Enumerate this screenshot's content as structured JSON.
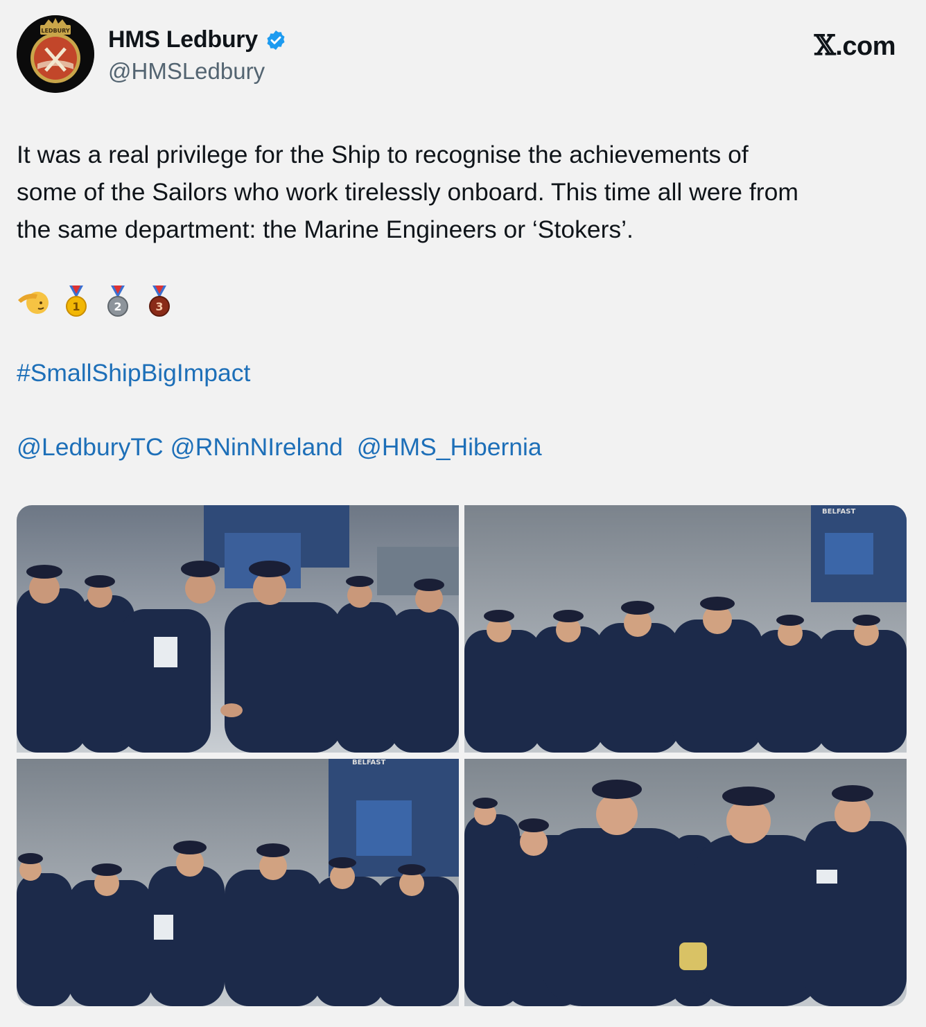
{
  "author": {
    "display_name": "HMS Ledbury",
    "handle": "@HMSLedbury",
    "verified": true,
    "avatar_crest_text": "LEDBURY"
  },
  "brand": {
    "x_glyph": "𝕏",
    "suffix": ".com"
  },
  "tweet": {
    "text_lines": [
      "It was a real privilege for the Ship to recognise the achievements of",
      "some of the Sailors who work tirelessly onboard. This time all were from",
      "the same department: the Marine Engineers or ‘Stokers’."
    ],
    "emojis": [
      "salute-emoji",
      "gold-medal-emoji",
      "silver-medal-emoji",
      "bronze-medal-emoji"
    ],
    "medal_numbers": [
      "1",
      "2",
      "3"
    ],
    "hashtag": "#SmallShipBigImpact",
    "mentions": [
      "@LedburyTC",
      "@RNinNIreland",
      "@HMS_Hibernia"
    ]
  },
  "photos": [
    {
      "id": "photo-1",
      "alt": "Sailors applauding as an officer shakes hands with a sailor"
    },
    {
      "id": "photo-2",
      "alt": "Group of sailors in navy uniforms on deck",
      "sign_text": "BELFAST"
    },
    {
      "id": "photo-3",
      "alt": "Officer presenting a badge to a sailor",
      "sign_text": "BELFAST"
    },
    {
      "id": "photo-4",
      "alt": "Officer presenting an award to a smiling sailor"
    }
  ],
  "colors": {
    "link": "#1d6fb8",
    "verified": "#1d9bf0",
    "uniform": "#1c2a4a",
    "sky": "#b9c0c6"
  }
}
